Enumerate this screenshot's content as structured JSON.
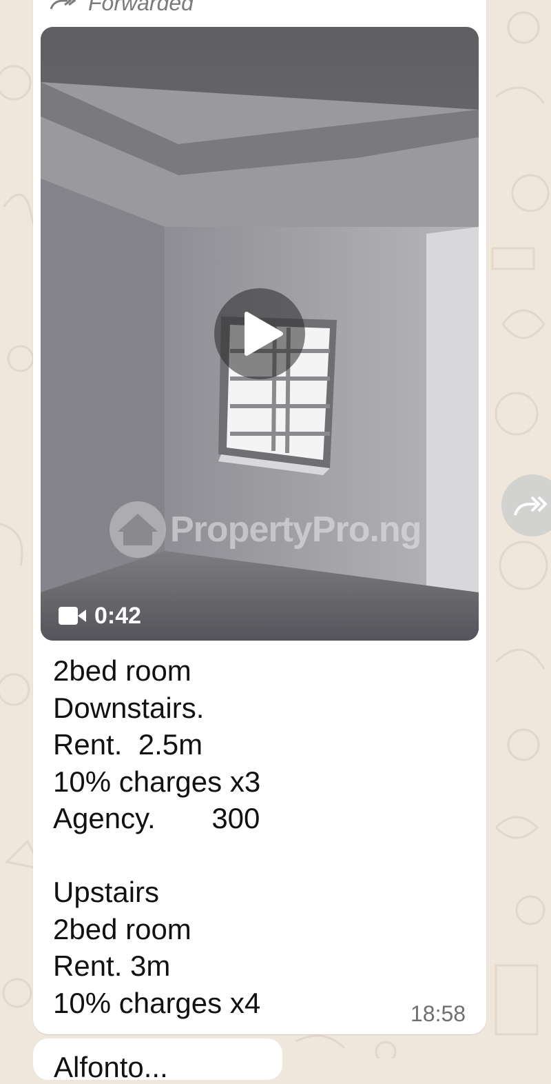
{
  "message": {
    "forwarded_label": "Forwarded",
    "video": {
      "duration": "0:42",
      "watermark_text": "PropertyPro.ng"
    },
    "caption_lines": [
      "2bed room",
      "Downstairs.",
      "Rent.  2.5m",
      "10% charges x3",
      "Agency.       300",
      "",
      "Upstairs",
      "2bed room",
      "Rent. 3m",
      "10% charges x4"
    ],
    "timestamp": "18:58"
  },
  "next_message": {
    "partial_text": "Alfonto..."
  },
  "icons": {
    "forwarded": "forward-arrows-icon",
    "play": "play-icon",
    "camera": "video-camera-icon",
    "forward_action": "forward-action-icon"
  },
  "colors": {
    "wallpaper": "#efe7dc",
    "bubble": "#ffffff",
    "meta_text": "#6f6f6f"
  }
}
